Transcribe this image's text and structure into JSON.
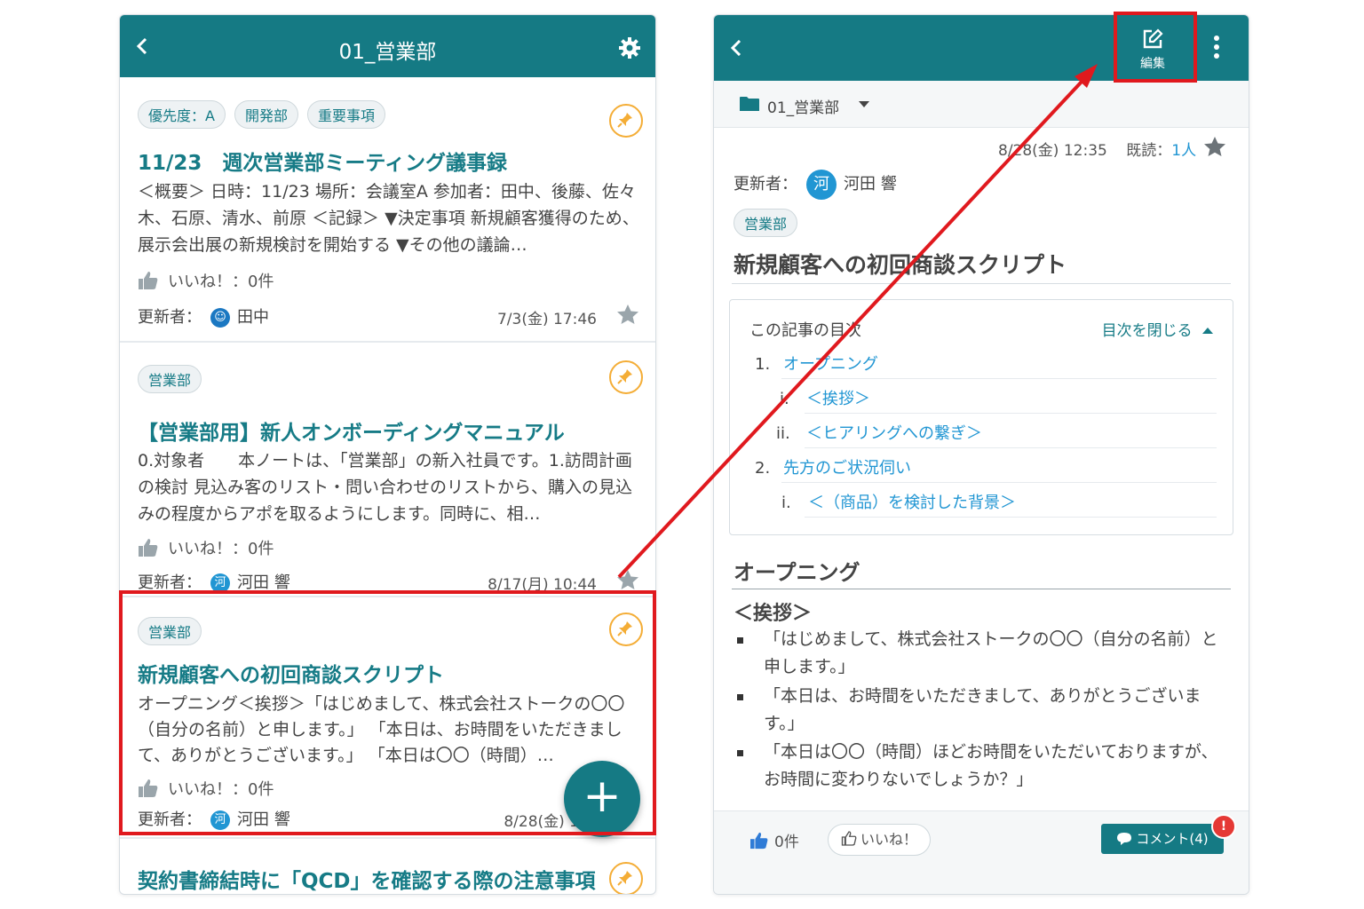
{
  "left": {
    "header_title": "01_営業部",
    "cards": [
      {
        "chips": [
          "優先度：A",
          "開発部",
          "重要事項"
        ],
        "title": "11/23　週次営業部ミーティング議事録",
        "body": "＜概要＞ 日時：11/23 場所：会議室A 参加者：田中、後藤、佐々木、石原、清水、前原 ＜記録＞ ▼決定事項 新規顧客獲得のため、展示会出展の新規検討を開始する ▼その他の議論…",
        "likes": "いいね！：0件",
        "updater_label": "更新者：",
        "updater_name": "田中",
        "date": "7/3(金) 17:46"
      },
      {
        "chips": [
          "営業部"
        ],
        "title": "【営業部用】新人オンボーディングマニュアル",
        "body": "0.対象者　　本ノートは、「営業部」の新入社員です。1.訪問計画の検討 見込み客のリスト・問い合わせのリストから、購入の見込みの程度からアポを取るようにします。同時に、相…",
        "likes": "いいね！：0件",
        "updater_label": "更新者：",
        "avatar_char": "河",
        "updater_name": "河田 響",
        "date": "8/17(月) 10:44"
      },
      {
        "chips": [
          "営業部"
        ],
        "title": "新規顧客への初回商談スクリプト",
        "body": "オープニング＜挨拶＞「はじめまして、株式会社ストークの〇〇（自分の名前）と申します。」 「本日は、お時間をいただきまして、ありがとうございます。」 「本日は〇〇（時間）…",
        "likes": "いいね！：0件",
        "updater_label": "更新者：",
        "avatar_char": "河",
        "updater_name": "河田 響",
        "date": "8/28(金) 1"
      },
      {
        "title": "契約書締結時に「QCD」を確認する際の注意事項"
      }
    ],
    "fab_label": "+"
  },
  "right": {
    "edit_label": "編集",
    "folder": "01_営業部",
    "date": "8/28(金) 12:35",
    "read_label": "既読：",
    "read_count": "1人",
    "updater_label": "更新者：",
    "avatar_char": "河",
    "updater_name": "河田 響",
    "chip": "営業部",
    "title": "新規顧客への初回商談スクリプト",
    "toc": {
      "heading": "この記事の目次",
      "toggle": "目次を閉じる",
      "items": [
        {
          "num": "1.",
          "label": "オープニング"
        },
        {
          "num": "i.",
          "label": "＜挨拶＞"
        },
        {
          "num": "ii.",
          "label": "＜ヒアリングへの繋ぎ＞"
        },
        {
          "num": "2.",
          "label": "先方のご状況伺い"
        },
        {
          "num": "i.",
          "label": "＜（商品）を検討した背景＞"
        }
      ]
    },
    "section_title": "オープニング",
    "sub_title": "＜挨拶＞",
    "bullets": [
      "「はじめまして、株式会社ストークの〇〇（自分の名前）と申します。」",
      "「本日は、お時間をいただきまして、ありがとうございます。」",
      "「本日は〇〇（時間）ほどお時間をいただいておりますが、お時間に変わりないでしょうか？」"
    ],
    "footer": {
      "like_count": "0件",
      "like_button": "いいね！",
      "comment_button": "コメント(4)",
      "badge": "!"
    }
  },
  "colors": {
    "header": "#157a84",
    "link": "#2196d3",
    "pin": "#f4ad36",
    "highlight": "#e0191e"
  }
}
